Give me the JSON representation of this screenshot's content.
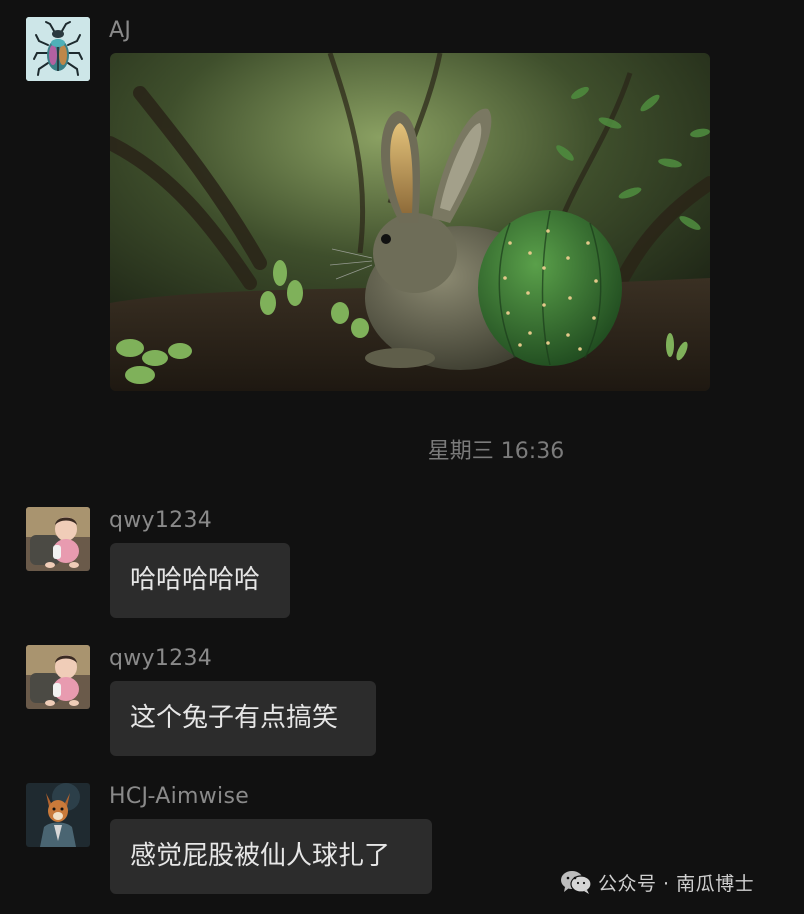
{
  "messages": [
    {
      "sender": "AJ",
      "avatar": "beetle-avatar",
      "type": "image",
      "image_desc_icon": "rabbit-cactus-photo"
    },
    {
      "sender": "qwy1234",
      "avatar": "baby-avatar",
      "type": "text",
      "text": "哈哈哈哈哈"
    },
    {
      "sender": "qwy1234",
      "avatar": "baby-avatar",
      "type": "text",
      "text": "这个兔子有点搞笑"
    },
    {
      "sender": "HCJ-Aimwise",
      "avatar": "fox-suit-avatar",
      "type": "text",
      "text": "感觉屁股被仙人球扎了"
    }
  ],
  "timestamp": "星期三 16:36",
  "watermark": {
    "icon": "wechat-icon",
    "text": "公众号 · 南瓜博士"
  },
  "colors": {
    "background": "#111111",
    "bubble": "#2c2c2c",
    "sender_text": "#8a8a8a",
    "message_text": "#e6e6e6",
    "timestamp_text": "#7b7b7b"
  }
}
